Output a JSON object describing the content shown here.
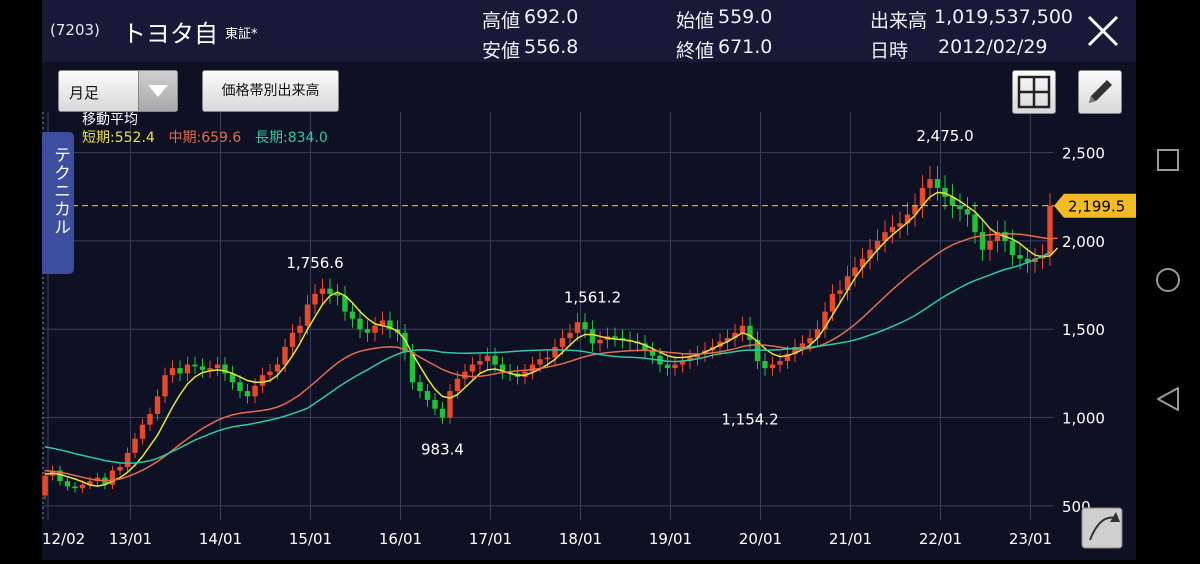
{
  "header": {
    "code": "(7203)",
    "name": "トヨタ自",
    "exchange": "東証*",
    "high_label": "高値",
    "high": "692.0",
    "low_label": "安値",
    "low": "556.8",
    "open_label": "始値",
    "open": "559.0",
    "close_label": "終値",
    "close": "671.0",
    "volume_label": "出来高",
    "volume": "1,019,537,500",
    "date_label": "日時",
    "date": "2012/02/29"
  },
  "toolbar": {
    "period": "月足",
    "volume_profile_label": "価格帯別出来高"
  },
  "technical_tab": "テクニカル",
  "colors": {
    "up": "#e8492b",
    "down": "#1fc43b",
    "ma_short": "#e9e33b",
    "ma_mid": "#e36d4b",
    "ma_long": "#2ec9a0",
    "price_marker": "#f1bb24"
  },
  "chart_data": {
    "type": "candlestick",
    "title": "移動平均",
    "legend": [
      {
        "name": "短期",
        "value": "552.4",
        "color": "#e9e33b"
      },
      {
        "name": "中期",
        "value": "659.6",
        "color": "#e36d4b"
      },
      {
        "name": "長期",
        "value": "834.0",
        "color": "#2ec9a0"
      }
    ],
    "ylim": [
      420,
      2730
    ],
    "yticks": [
      500,
      1000,
      1500,
      2000,
      2500
    ],
    "ytick_labels": [
      "500",
      "1,000",
      "1,500",
      "2,000",
      "2,500"
    ],
    "x_start": "2012-02",
    "xtick_labels": [
      "12/02",
      "13/01",
      "14/01",
      "15/01",
      "16/01",
      "17/01",
      "18/01",
      "19/01",
      "20/01",
      "21/01",
      "22/01",
      "23/01"
    ],
    "xtick_months": [
      0,
      11,
      23,
      35,
      47,
      59,
      71,
      83,
      95,
      107,
      119,
      131
    ],
    "current_price": 2199.5,
    "current_price_label": "2,199.5",
    "annotations": [
      {
        "text": "1,756.6",
        "month": 36,
        "value": 1756.6,
        "pos": "above"
      },
      {
        "text": "983.4",
        "month": 53,
        "value": 983.4,
        "pos": "below"
      },
      {
        "text": "1,561.2",
        "month": 73,
        "value": 1561.2,
        "pos": "above"
      },
      {
        "text": "1,154.2",
        "month": 94,
        "value": 1154.2,
        "pos": "below"
      },
      {
        "text": "2,475.0",
        "month": 120,
        "value": 2475.0,
        "pos": "above"
      }
    ],
    "closes": [
      671,
      700,
      640,
      610,
      600,
      620,
      640,
      660,
      620,
      700,
      720,
      800,
      880,
      960,
      1020,
      1120,
      1240,
      1280,
      1250,
      1300,
      1290,
      1270,
      1280,
      1300,
      1250,
      1200,
      1150,
      1120,
      1180,
      1240,
      1260,
      1300,
      1400,
      1480,
      1520,
      1640,
      1700,
      1730,
      1700,
      1690,
      1600,
      1560,
      1500,
      1480,
      1520,
      1550,
      1500,
      1480,
      1370,
      1200,
      1150,
      1100,
      1050,
      1000,
      1150,
      1220,
      1260,
      1300,
      1320,
      1350,
      1300,
      1260,
      1250,
      1230,
      1260,
      1300,
      1330,
      1340,
      1400,
      1450,
      1480,
      1540,
      1500,
      1420,
      1440,
      1460,
      1450,
      1440,
      1430,
      1420,
      1380,
      1350,
      1300,
      1280,
      1300,
      1320,
      1340,
      1360,
      1380,
      1400,
      1430,
      1450,
      1480,
      1520,
      1440,
      1320,
      1280,
      1300,
      1320,
      1360,
      1400,
      1420,
      1450,
      1500,
      1600,
      1700,
      1720,
      1800,
      1850,
      1900,
      1950,
      2000,
      2050,
      2080,
      2100,
      2150,
      2200,
      2300,
      2350,
      2300,
      2250,
      2200,
      2180,
      2150,
      2050,
      1950,
      2000,
      2050,
      2000,
      1920,
      1900,
      1880,
      1900,
      1920,
      2199.5
    ],
    "ma_short": [
      680,
      684,
      678,
      665,
      652,
      636,
      618,
      612,
      620,
      640,
      660,
      690,
      730,
      780,
      840,
      900,
      980,
      1060,
      1130,
      1190,
      1230,
      1255,
      1265,
      1270,
      1265,
      1250,
      1230,
      1210,
      1200,
      1200,
      1210,
      1240,
      1290,
      1350,
      1420,
      1500,
      1570,
      1640,
      1690,
      1710,
      1690,
      1650,
      1600,
      1560,
      1530,
      1520,
      1510,
      1490,
      1440,
      1360,
      1290,
      1220,
      1160,
      1120,
      1110,
      1130,
      1170,
      1210,
      1250,
      1270,
      1275,
      1265,
      1250,
      1240,
      1240,
      1255,
      1275,
      1300,
      1330,
      1370,
      1410,
      1450,
      1470,
      1470,
      1460,
      1450,
      1445,
      1440,
      1435,
      1425,
      1410,
      1390,
      1370,
      1350,
      1340,
      1340,
      1345,
      1355,
      1370,
      1390,
      1410,
      1430,
      1455,
      1480,
      1465,
      1430,
      1390,
      1360,
      1345,
      1350,
      1365,
      1385,
      1410,
      1450,
      1510,
      1580,
      1650,
      1720,
      1790,
      1850,
      1900,
      1950,
      1995,
      2035,
      2070,
      2105,
      2145,
      2200,
      2250,
      2275,
      2270,
      2250,
      2225,
      2195,
      2165,
      2120,
      2070,
      2040,
      2025,
      2010,
      1985,
      1950,
      1920,
      1910,
      1915,
      1960
    ],
    "ma_mid": [
      700,
      695,
      690,
      682,
      672,
      662,
      652,
      645,
      642,
      645,
      652,
      665,
      682,
      702,
      725,
      752,
      782,
      815,
      848,
      880,
      910,
      938,
      962,
      985,
      1002,
      1015,
      1024,
      1030,
      1035,
      1040,
      1048,
      1060,
      1078,
      1102,
      1130,
      1165,
      1200,
      1238,
      1275,
      1310,
      1338,
      1360,
      1375,
      1385,
      1392,
      1398,
      1400,
      1398,
      1385,
      1365,
      1342,
      1318,
      1295,
      1272,
      1255,
      1242,
      1235,
      1232,
      1234,
      1240,
      1248,
      1255,
      1260,
      1264,
      1268,
      1272,
      1278,
      1285,
      1295,
      1305,
      1318,
      1332,
      1345,
      1355,
      1362,
      1368,
      1372,
      1375,
      1378,
      1380,
      1380,
      1378,
      1375,
      1370,
      1366,
      1362,
      1360,
      1360,
      1362,
      1366,
      1372,
      1380,
      1390,
      1402,
      1410,
      1412,
      1410,
      1405,
      1398,
      1392,
      1388,
      1388,
      1392,
      1402,
      1418,
      1440,
      1465,
      1495,
      1528,
      1565,
      1605,
      1645,
      1685,
      1725,
      1762,
      1798,
      1832,
      1866,
      1898,
      1928,
      1955,
      1978,
      1995,
      2010,
      2022,
      2030,
      2035,
      2038,
      2040,
      2040,
      2038,
      2032,
      2025,
      2018,
      2012,
      2015
    ]
  }
}
